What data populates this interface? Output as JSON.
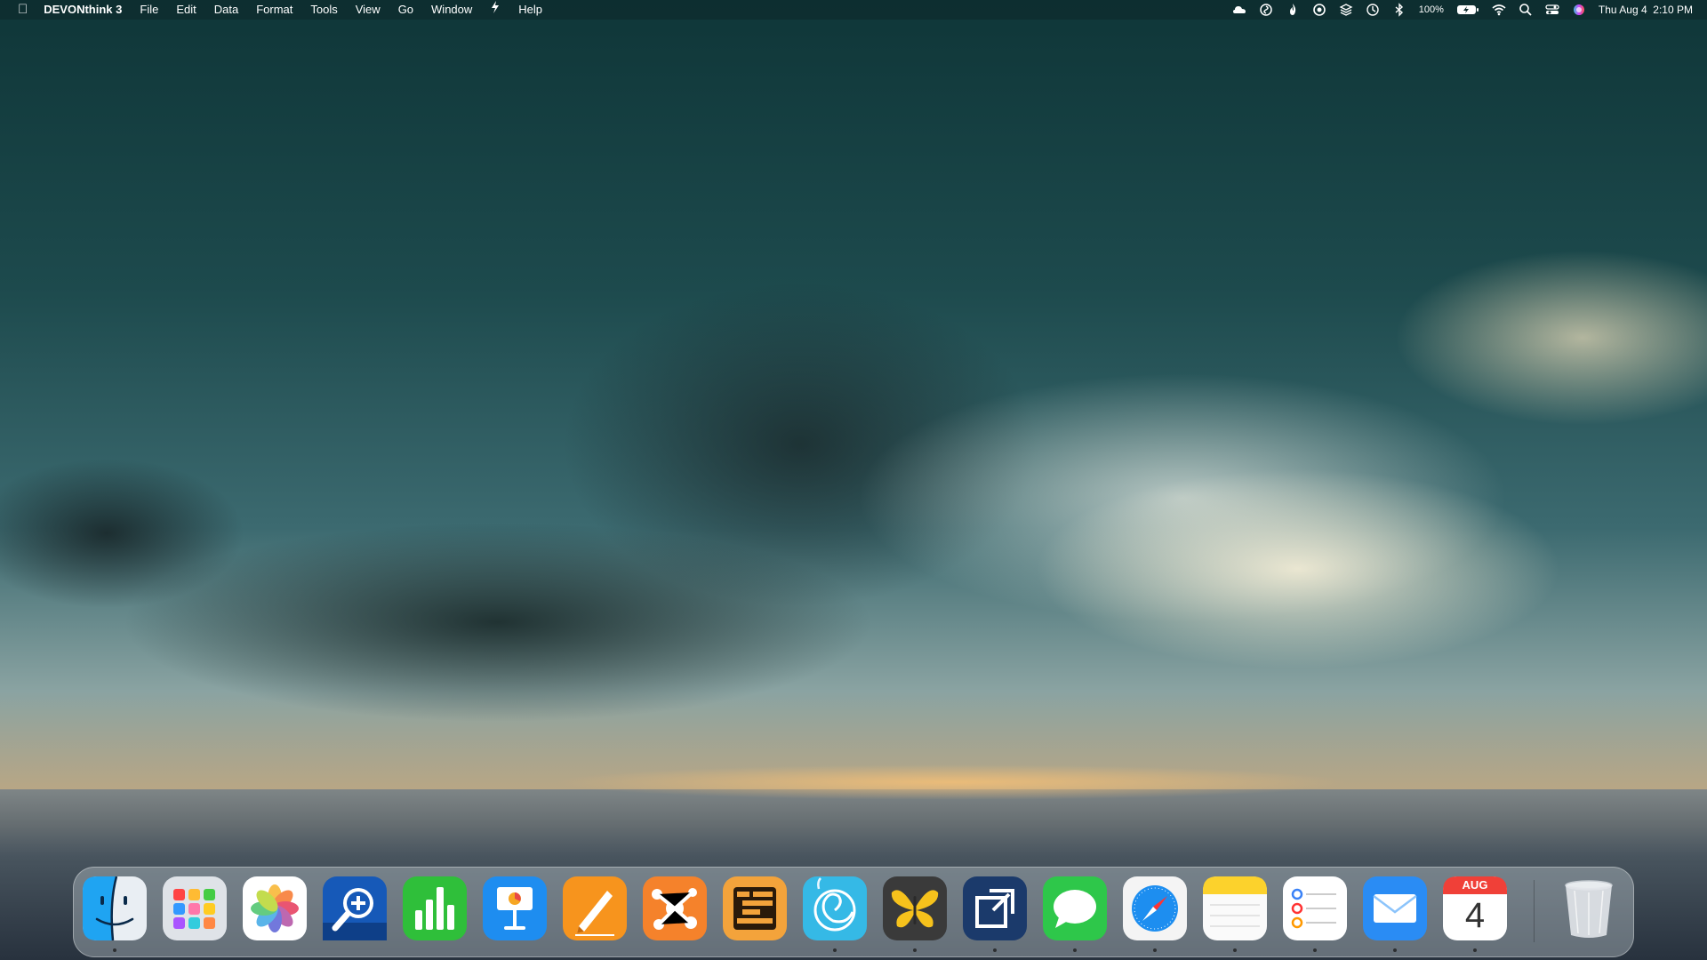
{
  "menubar": {
    "apple": "",
    "app_name": "DEVONthink 3",
    "menus": [
      "File",
      "Edit",
      "Data",
      "Format",
      "Tools",
      "View",
      "Go",
      "Window",
      "Help"
    ],
    "battery_text": "100%",
    "datetime": "Thu Aug 4  2:10 PM"
  },
  "dock": {
    "apps": [
      {
        "name": "finder",
        "running": true
      },
      {
        "name": "launchpad",
        "running": false
      },
      {
        "name": "photos",
        "running": false
      },
      {
        "name": "zoom-magnifier",
        "running": false
      },
      {
        "name": "numbers",
        "running": false
      },
      {
        "name": "keynote",
        "running": false
      },
      {
        "name": "pages",
        "running": false
      },
      {
        "name": "mindnode",
        "running": false
      },
      {
        "name": "omnioutliner",
        "running": false
      },
      {
        "name": "devonthink",
        "running": true
      },
      {
        "name": "tes-butterfly",
        "running": true
      },
      {
        "name": "resize-app",
        "running": true
      },
      {
        "name": "messages",
        "running": true
      },
      {
        "name": "safari",
        "running": true
      },
      {
        "name": "notes",
        "running": true
      },
      {
        "name": "reminders",
        "running": true
      },
      {
        "name": "mail",
        "running": true
      },
      {
        "name": "calendar",
        "running": true
      }
    ],
    "calendar": {
      "month": "AUG",
      "day": "4"
    },
    "trash": {
      "name": "trash"
    }
  },
  "colors": {
    "menubar_bg": "#0c282a",
    "dock_bg": "#c8d2d7"
  }
}
